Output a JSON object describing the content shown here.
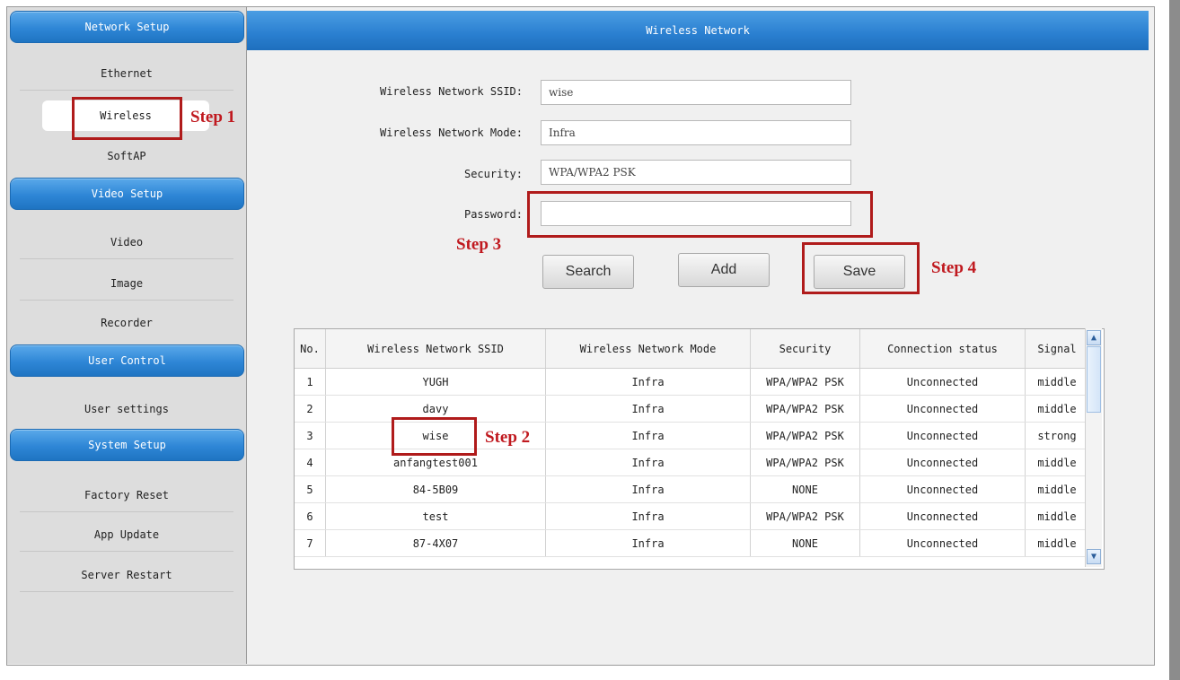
{
  "sidebar": {
    "sections": [
      {
        "title": "Network Setup",
        "items": [
          "Ethernet",
          "Wireless",
          "SoftAP"
        ]
      },
      {
        "title": "Video Setup",
        "items": [
          "Video",
          "Image",
          "Recorder"
        ]
      },
      {
        "title": "User Control",
        "items": [
          "User settings"
        ]
      },
      {
        "title": "System Setup",
        "items": [
          "Factory Reset",
          "App Update",
          "Server Restart"
        ]
      }
    ],
    "active_item": "Wireless"
  },
  "main": {
    "title": "Wireless Network",
    "form": {
      "ssid_label": "Wireless Network SSID:",
      "ssid_value": "wise",
      "mode_label": "Wireless Network Mode:",
      "mode_value": "Infra",
      "security_label": "Security:",
      "security_value": "WPA/WPA2 PSK",
      "password_label": "Password:",
      "password_value": ""
    },
    "buttons": {
      "search": "Search",
      "add": "Add",
      "save": "Save"
    },
    "table": {
      "headers": [
        "No.",
        "Wireless Network SSID",
        "Wireless Network Mode",
        "Security",
        "Connection status",
        "Signal"
      ],
      "rows": [
        [
          "1",
          "YUGH",
          "Infra",
          "WPA/WPA2 PSK",
          "Unconnected",
          "middle"
        ],
        [
          "2",
          "davy",
          "Infra",
          "WPA/WPA2 PSK",
          "Unconnected",
          "middle"
        ],
        [
          "3",
          "wise",
          "Infra",
          "WPA/WPA2 PSK",
          "Unconnected",
          "strong"
        ],
        [
          "4",
          "anfangtest001",
          "Infra",
          "WPA/WPA2 PSK",
          "Unconnected",
          "middle"
        ],
        [
          "5",
          "84-5B09",
          "Infra",
          "NONE",
          "Unconnected",
          "middle"
        ],
        [
          "6",
          "test",
          "Infra",
          "WPA/WPA2 PSK",
          "Unconnected",
          "middle"
        ],
        [
          "7",
          "87-4X07",
          "Infra",
          "NONE",
          "Unconnected",
          "middle"
        ]
      ]
    }
  },
  "annotations": {
    "step1": "Step 1",
    "step2": "Step 2",
    "step3": "Step 3",
    "step4": "Step 4"
  },
  "colors": {
    "header_blue": "#2e86d6",
    "annotation_red": "#b01b1b"
  }
}
